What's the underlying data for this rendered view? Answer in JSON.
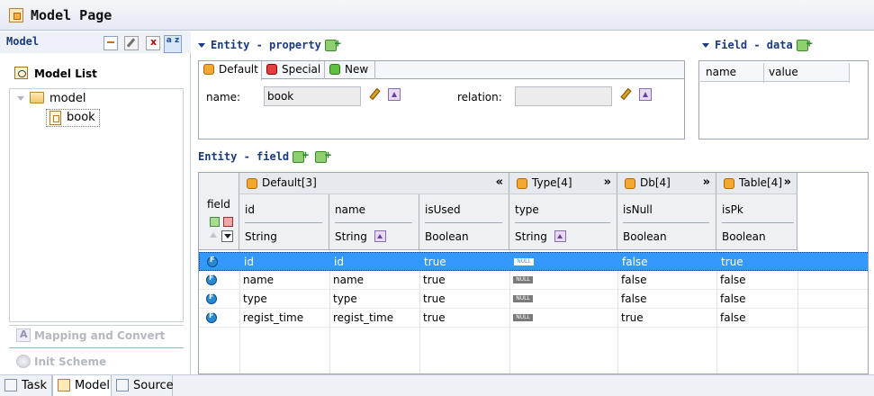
{
  "window": {
    "title": "Model Page"
  },
  "left_panel": {
    "title": "Model",
    "toolbar": [
      "import-icon",
      "edit-icon",
      "delete-icon",
      "sort-az-icon"
    ],
    "sort_label": "a z",
    "model_list_label": "Model List",
    "tree": {
      "root": "model",
      "children": [
        "book"
      ]
    },
    "nav": {
      "mapping": "Mapping and Convert",
      "init": "Init Scheme"
    }
  },
  "bottom_tabs": {
    "task": "Task",
    "model": "Model",
    "source": "Source"
  },
  "entity_property": {
    "title": "Entity - property",
    "tabs": [
      "Default",
      "Special",
      "New"
    ],
    "name_label": "name:",
    "name_value": "book",
    "relation_label": "relation:",
    "relation_value": ""
  },
  "field_data": {
    "title": "Field - data",
    "columns": [
      "name",
      "value"
    ]
  },
  "entity_field": {
    "title": "Entity - field",
    "field_col_label": "field",
    "groups": [
      {
        "label": "Default[3]",
        "arrow": "«"
      },
      {
        "label": "Type[4]",
        "arrow": "»"
      },
      {
        "label": "Db[4]",
        "arrow": "»"
      },
      {
        "label": "Table[4]",
        "arrow": "»"
      }
    ],
    "columns": [
      {
        "name": "id",
        "type": "String"
      },
      {
        "name": "name",
        "type": "String"
      },
      {
        "name": "isUsed",
        "type": "Boolean"
      },
      {
        "name": "type",
        "type": "String"
      },
      {
        "name": "isNull",
        "type": "Boolean"
      },
      {
        "name": "isPk",
        "type": "Boolean"
      }
    ],
    "null_badge": "NULL",
    "rows": [
      {
        "id": "id",
        "name": "id",
        "isUsed": "true",
        "isNull": "false",
        "isPk": "true",
        "selected": true
      },
      {
        "id": "name",
        "name": "name",
        "isUsed": "true",
        "isNull": "false",
        "isPk": "false"
      },
      {
        "id": "type",
        "name": "type",
        "isUsed": "true",
        "isNull": "false",
        "isPk": "false"
      },
      {
        "id": "regist_time",
        "name": "regist_time",
        "isUsed": "true",
        "isNull": "true",
        "isPk": "false"
      }
    ]
  },
  "colors": {
    "accent_blue": "#3399ff",
    "section_title": "#1a3a7a",
    "panel_border": "#9aa6b8"
  }
}
